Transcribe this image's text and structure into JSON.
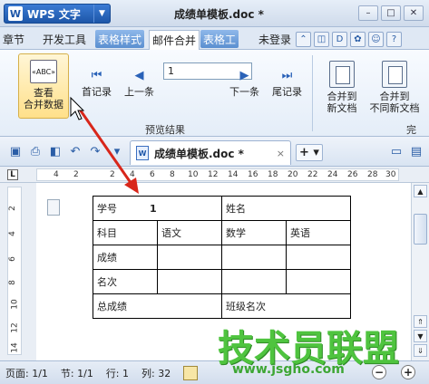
{
  "titlebar": {
    "app_name": "WPS 文字",
    "app_logo": "W",
    "document_title": "成绩单模板.doc *"
  },
  "tabs": [
    {
      "label": "章节"
    },
    {
      "label": "开发工具"
    },
    {
      "label": "表格样式"
    },
    {
      "label": "邮件合并"
    },
    {
      "label": "表格工"
    }
  ],
  "account": {
    "login_label": "未登录"
  },
  "ribbon": {
    "view_merge_data_line1": "查看",
    "view_merge_data_line2": "合并数据",
    "abc_icon_text": "«ABC»",
    "first_record": "首记录",
    "prev_record": "上一条",
    "record_number": "1",
    "next_record": "下一条",
    "last_record": "尾记录",
    "merge_new_doc_line1": "合并到",
    "merge_new_doc_line2": "新文档",
    "merge_diff_doc_line1": "合并到",
    "merge_diff_doc_line2": "不同新文档",
    "preview_group_label": "预览结果",
    "cut_group_label": "完"
  },
  "doc_tab": {
    "name": "成绩单模板.doc *",
    "close": "×"
  },
  "ruler": {
    "ticks": [
      "4",
      "2",
      "2",
      "4",
      "6",
      "8",
      "10",
      "12",
      "14",
      "16",
      "18",
      "20",
      "22",
      "24",
      "26",
      "28",
      "30"
    ],
    "vticks": [
      "2",
      "4",
      "6",
      "8",
      "10",
      "12",
      "14"
    ],
    "corner": "L"
  },
  "table": {
    "row1": {
      "c1": "学号",
      "c1_value": "1",
      "c2": "姓名"
    },
    "row2": {
      "c1": "科目",
      "c2": "语文",
      "c3": "数学",
      "c4": "英语"
    },
    "row3": {
      "c1": "成绩"
    },
    "row4": {
      "c1": "名次"
    },
    "row5": {
      "c1": "总成绩",
      "c2": "班级名次"
    }
  },
  "statusbar": {
    "page": "页面: 1/1",
    "section": "节: 1/1",
    "row": "行: 1",
    "col": "列: 32",
    "zoom_minus": "−",
    "zoom_plus": "+"
  },
  "watermark": {
    "logo": "技术员联盟",
    "url": "www.jsgho.com"
  },
  "colors": {
    "accent": "#1d56a8",
    "highlight": "#ffe08a",
    "watermark": "#4fc43f",
    "arrow": "#d8261a"
  }
}
